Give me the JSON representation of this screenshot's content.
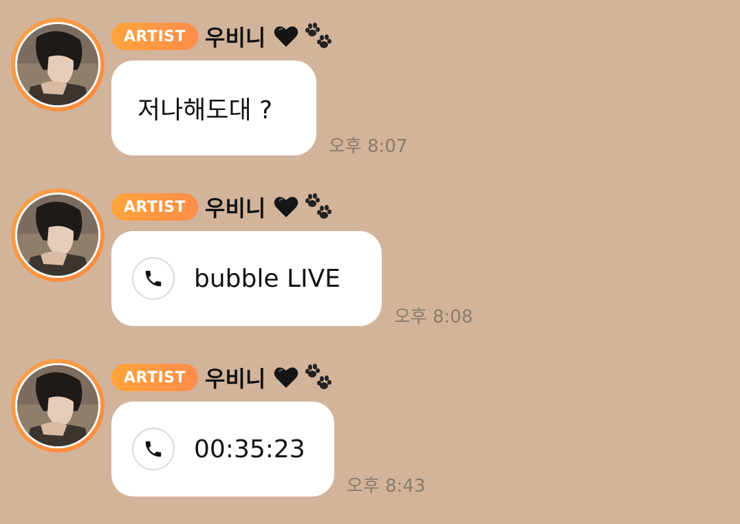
{
  "messages": [
    {
      "badge": "ARTIST",
      "sender": "우비니",
      "text": "저나해도대 ?",
      "time": "오후 8:07",
      "type": "text"
    },
    {
      "badge": "ARTIST",
      "sender": "우비니",
      "text": "bubble LIVE",
      "time": "오후 8:08",
      "type": "call",
      "icon": "phone-icon"
    },
    {
      "badge": "ARTIST",
      "sender": "우비니",
      "text": "00:35:23",
      "time": "오후 8:43",
      "type": "call",
      "icon": "phone-icon"
    }
  ],
  "colors": {
    "background": "#d2b49b",
    "badge": "#ff9a3c",
    "bubble": "#ffffff",
    "time": "#8a7a6a"
  }
}
